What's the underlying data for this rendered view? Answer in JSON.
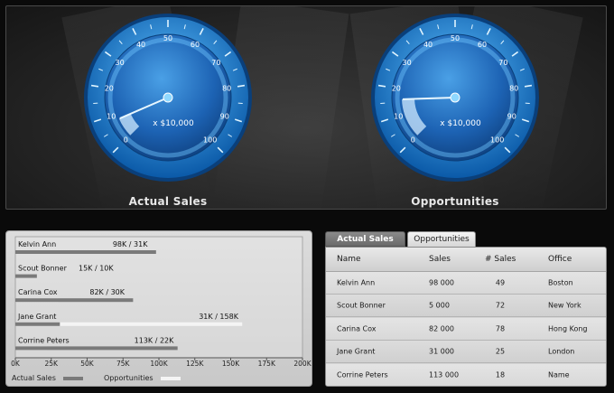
{
  "gauges": [
    {
      "id": "actual-sales",
      "title": "Actual Sales",
      "scale_label": "x $10,000",
      "value": 8,
      "ticks": [
        "0",
        "10",
        "20",
        "30",
        "40",
        "50",
        "60",
        "70",
        "80",
        "90",
        "100"
      ],
      "min": 0,
      "max": 100
    },
    {
      "id": "opportunities",
      "title": "Opportunities",
      "scale_label": "x $10,000",
      "value": 16,
      "ticks": [
        "0",
        "10",
        "20",
        "30",
        "40",
        "50",
        "60",
        "70",
        "80",
        "90",
        "100"
      ],
      "min": 0,
      "max": 100
    }
  ],
  "chart_data": {
    "type": "bar",
    "orientation": "horizontal",
    "categories": [
      "Kelvin Ann",
      "Scout Bonner",
      "Carina Cox",
      "Jane  Grant",
      "Corrine Peters"
    ],
    "series": [
      {
        "name": "Actual Sales",
        "values": [
          98,
          15,
          82,
          31,
          113
        ]
      },
      {
        "name": "Opportunities",
        "values": [
          31,
          10,
          30,
          158,
          22
        ]
      }
    ],
    "value_labels": [
      "98K  /  31K",
      "15K  /  10K",
      "82K  / 30K",
      "31K  /  158K",
      "113K  /  22K"
    ],
    "x_ticks": [
      "0K",
      "25K",
      "50K",
      "75K",
      "100K",
      "125K",
      "150K",
      "175K",
      "200K"
    ],
    "xlim": [
      0,
      200
    ],
    "colors": {
      "actual": "#7a7a7a",
      "opportunities": "#f4f4f4"
    },
    "legend": {
      "actual": "Actual Sales",
      "opportunities": "Opportunities"
    }
  },
  "tabs": [
    {
      "label": "Actual Sales",
      "active": true
    },
    {
      "label": "Opportunities",
      "active": false
    }
  ],
  "table": {
    "columns": [
      "Name",
      "Sales",
      "# Sales",
      "Office"
    ],
    "rows": [
      [
        "Kelvin Ann",
        "98 000",
        "49",
        "Boston"
      ],
      [
        "Scout Bonner",
        "5 000",
        "72",
        "New York"
      ],
      [
        "Carina Cox",
        "82 000",
        "78",
        "Hong Kong"
      ],
      [
        "Jane  Grant",
        "31 000",
        "25",
        "London"
      ],
      [
        "Corrine Peters",
        "113 000",
        "18",
        "Name"
      ]
    ]
  },
  "colors": {
    "gauge_blue": "#1b8fd8",
    "gauge_dark": "#0c4f95",
    "accent_light": "#6fd3ff"
  }
}
